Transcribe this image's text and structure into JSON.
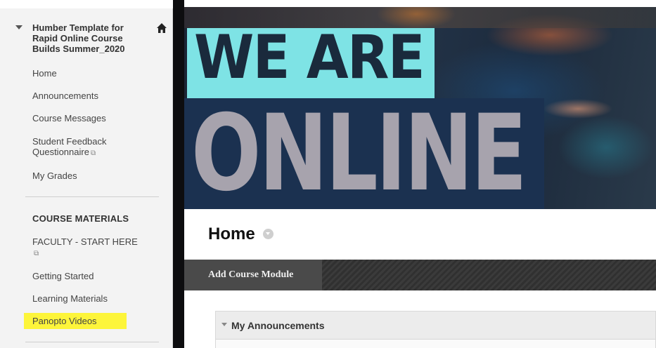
{
  "sidebar": {
    "course_title": "Humber Template for Rapid Online Course Builds Summer_2020",
    "items": [
      {
        "label": "Home"
      },
      {
        "label": "Announcements"
      },
      {
        "label": "Course Messages"
      },
      {
        "label": "Student Feedback Questionnaire",
        "ext": "⧉"
      },
      {
        "label": "My Grades"
      }
    ],
    "section_heading": "COURSE MATERIALS",
    "section_items": [
      {
        "label": "FACULTY - START HERE",
        "ext": "⧉"
      },
      {
        "label": "Getting Started"
      },
      {
        "label": "Learning Materials"
      },
      {
        "label": "Panopto Videos"
      }
    ],
    "highlight_color": "#fdf53a"
  },
  "banner": {
    "line1": "WE ARE",
    "line2": "ONLINE",
    "colors": {
      "line1_bg": "#7ee3e5",
      "line2_bg": "#1b3150"
    }
  },
  "content": {
    "page_title": "Home",
    "action_bar": {
      "add_module_label": "Add Course Module"
    },
    "module": {
      "title": "My Announcements"
    }
  },
  "icons": {
    "home": "home-icon",
    "collapse": "triangle-down-icon",
    "external": "external-link-icon",
    "options": "chevron-down-circle-icon"
  }
}
